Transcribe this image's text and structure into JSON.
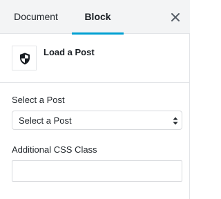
{
  "tabs": {
    "document_label": "Document",
    "block_label": "Block",
    "active": "Block",
    "active_color": "#00a0d2",
    "close_icon": "close-icon"
  },
  "block_card": {
    "icon": "shield-icon",
    "title": "Load a Post"
  },
  "post_select": {
    "label": "Select a Post",
    "selected_value": "Select a Post",
    "icon": "up-down-arrows-icon"
  },
  "css_class": {
    "label": "Additional CSS Class",
    "value": ""
  }
}
